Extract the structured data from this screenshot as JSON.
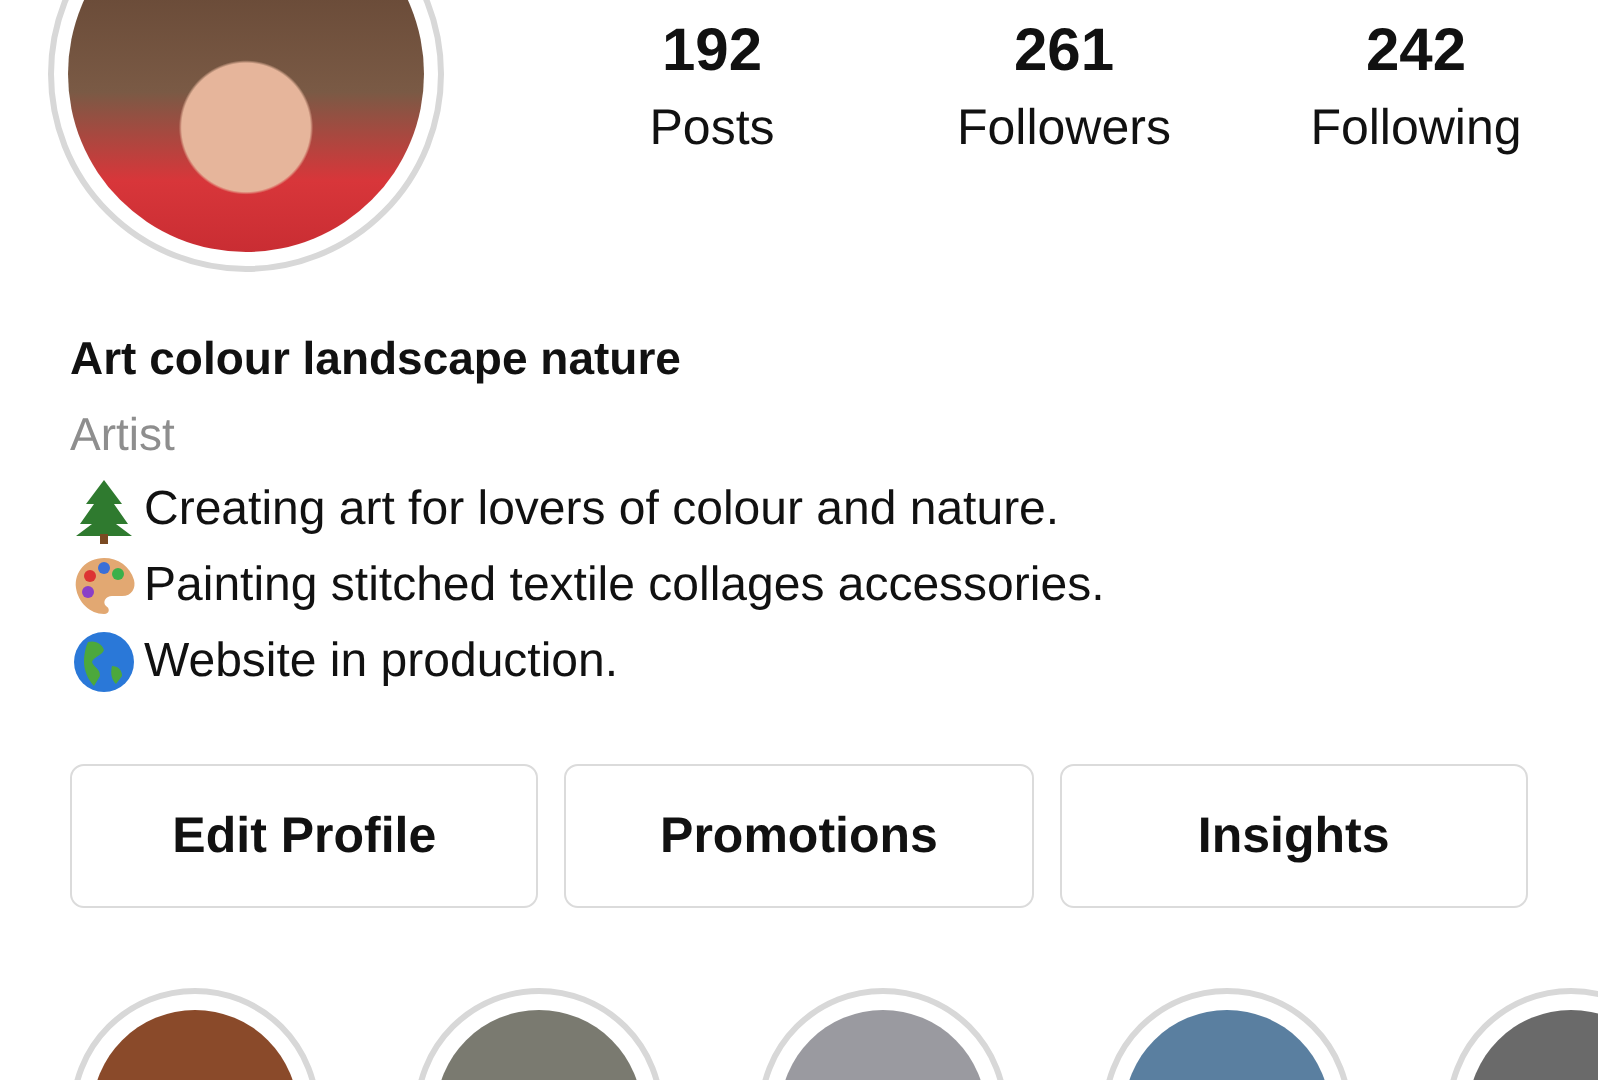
{
  "profile": {
    "stats": [
      {
        "value": "192",
        "label": "Posts"
      },
      {
        "value": "261",
        "label": "Followers"
      },
      {
        "value": "242",
        "label": "Following"
      }
    ],
    "name": "Art colour landscape nature",
    "category": "Artist",
    "bio": [
      {
        "kind": "tree",
        "text": "Creating art for lovers of colour and nature."
      },
      {
        "kind": "palette",
        "text": "Painting stitched textile collages accessories."
      },
      {
        "kind": "globe",
        "text": "Website in production."
      }
    ]
  },
  "buttons": [
    "Edit Profile",
    "Promotions",
    "Insights"
  ],
  "highlights": [
    {
      "color": "#8a4a2a"
    },
    {
      "color": "#7a7a70"
    },
    {
      "color": "#9a9aa0"
    },
    {
      "color": "#5a7fa0"
    },
    {
      "color": "#6a6a6a"
    }
  ]
}
